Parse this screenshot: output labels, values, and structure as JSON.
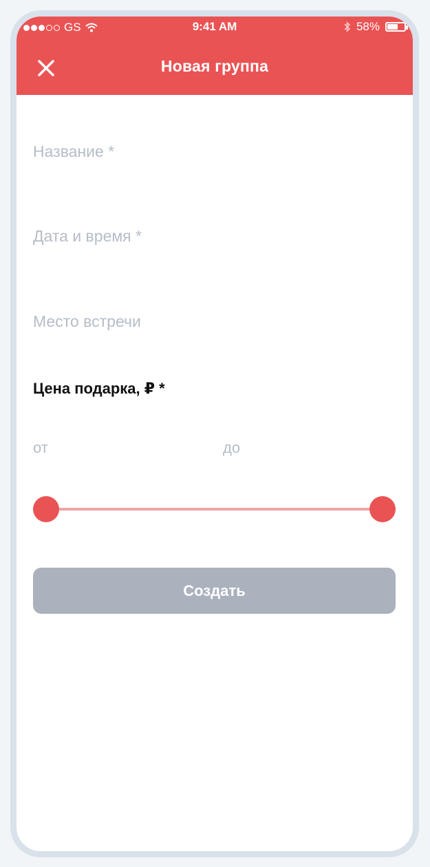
{
  "status_bar": {
    "carrier": "GS",
    "time": "9:41 AM",
    "battery": "58%",
    "icons": [
      "signal-dots-icon",
      "wifi-icon",
      "bluetooth-icon",
      "battery-icon"
    ]
  },
  "header": {
    "title": "Новая группа",
    "close_icon": "close-icon",
    "background_color": "#ea5354"
  },
  "form": {
    "name_placeholder": "Название *",
    "datetime_placeholder": "Дата и время *",
    "place_placeholder": "Место встречи",
    "price_label": "Цена подарка, ₽ *",
    "price_from_label": "от",
    "price_to_label": "до",
    "price_slider": {
      "min_position": 0,
      "max_position": 1
    },
    "create_button": "Создать"
  },
  "colors": {
    "accent": "#ea5354",
    "placeholder": "#b5bdc8",
    "button_disabled": "#abb2bd"
  }
}
